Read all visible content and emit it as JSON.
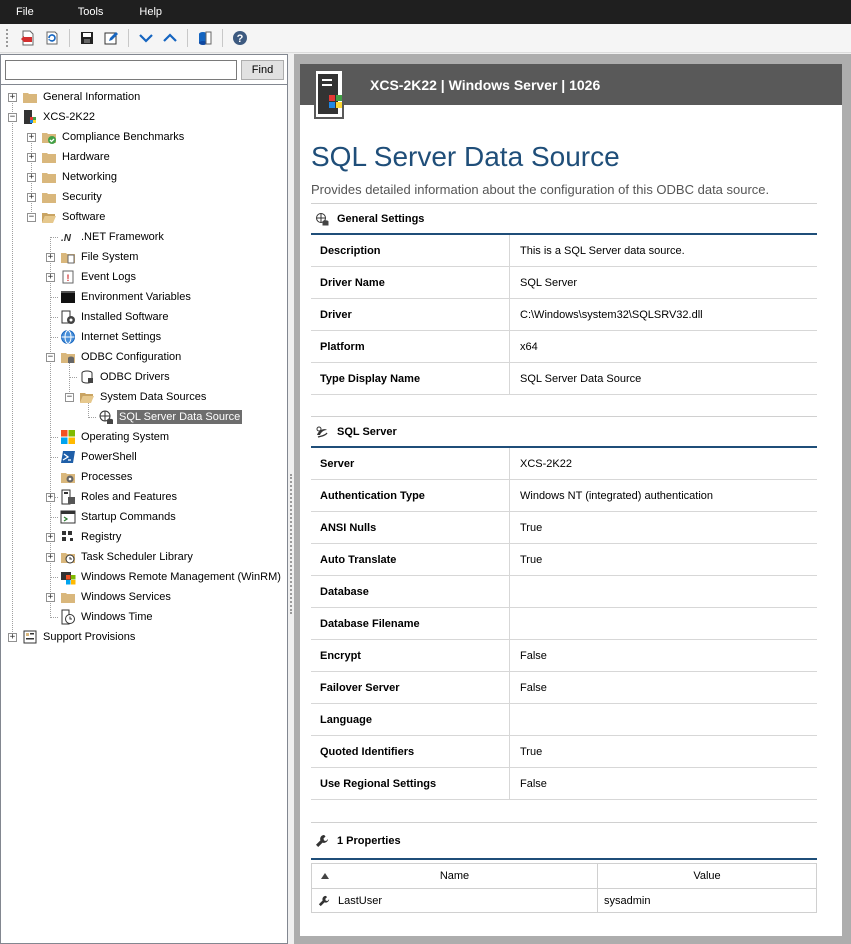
{
  "menu": [
    "File",
    "Tools",
    "Help"
  ],
  "toolbar": {
    "buttons": [
      "export-pdf-icon",
      "refresh-icon",
      "save-icon",
      "edit-icon",
      "move-down-icon",
      "move-up-icon",
      "database-icon",
      "help-icon"
    ]
  },
  "search": {
    "value": "",
    "placeholder": "",
    "find_label": "Find"
  },
  "tree": {
    "general_information": "General Information",
    "host": "XCS-2K22",
    "compliance_benchmarks": "Compliance Benchmarks",
    "hardware": "Hardware",
    "networking": "Networking",
    "security": "Security",
    "software": "Software",
    "net_framework": ".NET Framework",
    "file_system": "File System",
    "event_logs": "Event Logs",
    "environment_variables": "Environment Variables",
    "installed_software": "Installed Software",
    "internet_settings": "Internet Settings",
    "odbc_configuration": "ODBC Configuration",
    "odbc_drivers": "ODBC Drivers",
    "system_data_sources": "System Data Sources",
    "sql_server_data_source": "SQL Server Data Source",
    "operating_system": "Operating System",
    "powershell": "PowerShell",
    "processes": "Processes",
    "roles_and_features": "Roles and Features",
    "startup_commands": "Startup Commands",
    "registry": "Registry",
    "task_scheduler_library": "Task Scheduler Library",
    "windows_remote_management": "Windows Remote Management (WinRM)",
    "windows_services": "Windows Services",
    "windows_time": "Windows Time",
    "support_provisions": "Support Provisions"
  },
  "header": {
    "title": "XCS-2K22 | Windows Server | 1026"
  },
  "page": {
    "title": "SQL Server Data Source",
    "description": "Provides detailed information about the configuration of this ODBC data source."
  },
  "general_settings": {
    "title": "General Settings",
    "rows": [
      {
        "key": "Description",
        "value": "This is a SQL Server data source."
      },
      {
        "key": "Driver Name",
        "value": "SQL Server"
      },
      {
        "key": "Driver",
        "value": "C:\\Windows\\system32\\SQLSRV32.dll"
      },
      {
        "key": "Platform",
        "value": "x64"
      },
      {
        "key": "Type Display Name",
        "value": "SQL Server Data Source"
      }
    ]
  },
  "sql_server": {
    "title": "SQL Server",
    "rows": [
      {
        "key": "Server",
        "value": "XCS-2K22"
      },
      {
        "key": "Authentication Type",
        "value": "Windows NT (integrated) authentication"
      },
      {
        "key": "ANSI Nulls",
        "value": "True"
      },
      {
        "key": "Auto Translate",
        "value": "True"
      },
      {
        "key": "Database",
        "value": ""
      },
      {
        "key": "Database Filename",
        "value": ""
      },
      {
        "key": "Encrypt",
        "value": "False"
      },
      {
        "key": "Failover Server",
        "value": "False"
      },
      {
        "key": "Language",
        "value": ""
      },
      {
        "key": "Quoted Identifiers",
        "value": "True"
      },
      {
        "key": "Use Regional Settings",
        "value": "False"
      }
    ]
  },
  "properties": {
    "title": "1 Properties",
    "columns": [
      "Name",
      "Value"
    ],
    "rows": [
      {
        "name": "LastUser",
        "value": "sysadmin"
      }
    ]
  },
  "colors": {
    "accent": "#1f4e79",
    "header_bg": "#595959",
    "selection": "#6d6d6d"
  }
}
